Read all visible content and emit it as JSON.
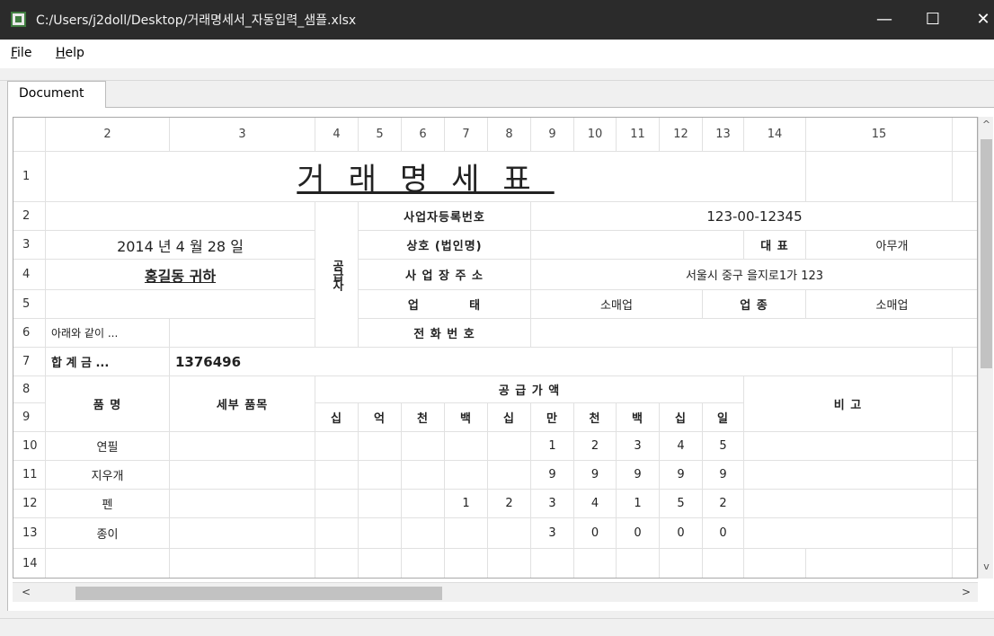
{
  "window": {
    "title": "C:/Users/j2doll/Desktop/거래명세서_자동입력_샘플.xlsx",
    "minimize": "—",
    "maximize": "☐",
    "close": "✕"
  },
  "menu": {
    "file_accel": "F",
    "file_rest": "ile",
    "help_accel": "H",
    "help_rest": "elp"
  },
  "tab": {
    "label": "Document"
  },
  "sheet": {
    "col_headers": [
      "2",
      "3",
      "4",
      "5",
      "6",
      "7",
      "8",
      "9",
      "10",
      "11",
      "12",
      "13",
      "14",
      "15"
    ],
    "row_headers": [
      "1",
      "2",
      "3",
      "4",
      "5",
      "6",
      "7",
      "8",
      "9",
      "10",
      "11",
      "12",
      "13",
      "14"
    ],
    "title": "거래명세표",
    "date": "2014 년 4 월 28 일",
    "recipient": "홍길동 귀하",
    "note": "아래와 같이 ...",
    "total_label": "합 계 금 ...",
    "total_value": "1376496",
    "supplier_label": "공급자",
    "reg_no_label": "사업자등록번호",
    "reg_no": "123-00-12345",
    "company_label": "상호 (법인명)",
    "rep_label": "대 표",
    "rep_value": "아무개",
    "address_label": "사 업 장 주 소",
    "address": "서울시 중구 을지로1가 123",
    "biztype_label": "업          태",
    "biztype": "소매업",
    "bizitem_label": "업 종",
    "bizitem": "소매업",
    "phone_label": "전 화 번 호",
    "item_label": "품 명",
    "detail_label": "세부 품목",
    "supply_label": "공 급 가 액",
    "remarks_label": "비 고",
    "units": [
      "십",
      "억",
      "천",
      "백",
      "십",
      "만",
      "천",
      "백",
      "십",
      "일"
    ],
    "items": [
      {
        "name": "연필",
        "digits": [
          "",
          "",
          "",
          "",
          "",
          "1",
          "2",
          "3",
          "4",
          "5"
        ]
      },
      {
        "name": "지우개",
        "digits": [
          "",
          "",
          "",
          "",
          "",
          "9",
          "9",
          "9",
          "9",
          "9"
        ]
      },
      {
        "name": "펜",
        "digits": [
          "",
          "",
          "",
          "1",
          "2",
          "3",
          "4",
          "1",
          "5",
          "2"
        ]
      },
      {
        "name": "종이",
        "digits": [
          "",
          "",
          "",
          "",
          "",
          "3",
          "0",
          "0",
          "0",
          "0"
        ]
      }
    ]
  },
  "scroll": {
    "up": "^",
    "down": "v",
    "left": "<",
    "right": ">"
  }
}
